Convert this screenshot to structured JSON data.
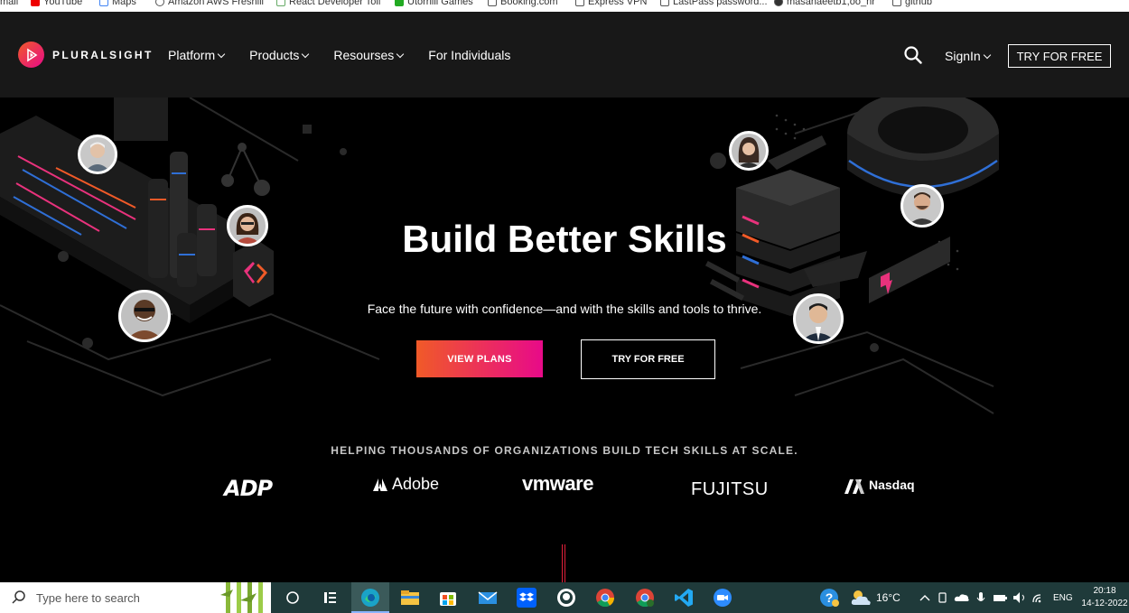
{
  "bookmarks": [
    {
      "label": "mail"
    },
    {
      "label": "YouTube"
    },
    {
      "label": "Maps"
    },
    {
      "label": "Amazon AWS Freshill"
    },
    {
      "label": "React Developer Toll"
    },
    {
      "label": "Utorrilli Games"
    },
    {
      "label": "Booking.com"
    },
    {
      "label": "Express VPN"
    },
    {
      "label": "LastPass password..."
    },
    {
      "label": "masahaeetb1,oo_nr"
    },
    {
      "label": "github"
    }
  ],
  "nav": {
    "brand": "PLURALSIGHT",
    "links": [
      {
        "label": "Platform",
        "dropdown": true
      },
      {
        "label": "Products",
        "dropdown": true
      },
      {
        "label": "Resourses",
        "dropdown": true
      },
      {
        "label": "For Individuals",
        "dropdown": false
      }
    ],
    "signin": "SignIn",
    "try_free": "TRY FOR FREE"
  },
  "hero": {
    "title": "Build Better Skills",
    "subtitle": "Face the future with confidence—and with the skills and tools to thrive.",
    "view_plans": "VIEW PLANS",
    "try_free": "TRY FOR FREE",
    "accent_gradient_start": "#f05a28",
    "accent_gradient_end": "#e80a89"
  },
  "partners": {
    "tagline": "HELPING THOUSANDS OF ORGANIZATIONS BUILD TECH SKILLS AT SCALE.",
    "logos": [
      "ADP",
      "Adobe",
      "vmware",
      "FUJITSU",
      "Nasdaq"
    ]
  },
  "taskbar": {
    "search_placeholder": "Type here to search",
    "weather": "16°C",
    "language": "ENG",
    "time": "20:18",
    "date": "14-12-2022",
    "apps": [
      "task-view-icon",
      "widgets-icon",
      "edge-icon",
      "file-explorer-icon",
      "store-icon",
      "mail-icon",
      "dropbox-icon",
      "github-icon",
      "chrome-icon",
      "chrome-canary-icon",
      "vscode-icon",
      "zoom-icon"
    ]
  }
}
